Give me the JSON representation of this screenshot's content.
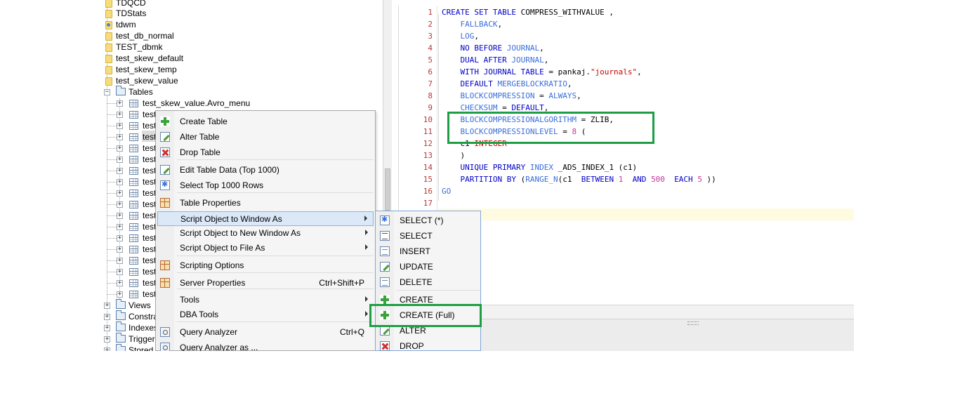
{
  "tree": {
    "top_items": [
      {
        "label": "TDQCD",
        "icon": "database-icon"
      },
      {
        "label": "TDStats",
        "icon": "database-icon"
      },
      {
        "label": "tdwm",
        "icon": "user-database-icon"
      },
      {
        "label": "test_db_normal",
        "icon": "database-icon"
      },
      {
        "label": "TEST_dbmk",
        "icon": "database-icon"
      },
      {
        "label": "test_skew_default",
        "icon": "database-icon"
      },
      {
        "label": "test_skew_temp",
        "icon": "database-icon"
      },
      {
        "label": "test_skew_value",
        "icon": "database-icon"
      }
    ],
    "tables_folder": "Tables",
    "first_table": "test_skew_value.Avro_menu",
    "truncated_table": "test",
    "bottom_folders": [
      "Views",
      "Constra",
      "Indexes",
      "Triggers",
      "Stored P"
    ]
  },
  "editor": {
    "line_numbers": [
      "1",
      "2",
      "3",
      "4",
      "5",
      "6",
      "7",
      "8",
      "9",
      "10",
      "11",
      "12",
      "13",
      "14",
      "15",
      "16",
      "17"
    ],
    "lines": [
      [
        {
          "t": "CREATE SET TABLE ",
          "c": "kw"
        },
        {
          "t": "COMPRESS_WITHVALUE ,",
          "c": ""
        }
      ],
      [
        {
          "t": "    FALLBACK",
          "c": "kw2"
        },
        {
          "t": ",",
          "c": ""
        }
      ],
      [
        {
          "t": "    LOG",
          "c": "kw2"
        },
        {
          "t": ",",
          "c": ""
        }
      ],
      [
        {
          "t": "    NO BEFORE ",
          "c": "kw"
        },
        {
          "t": "JOURNAL",
          "c": "kw2"
        },
        {
          "t": ",",
          "c": ""
        }
      ],
      [
        {
          "t": "    DUAL AFTER ",
          "c": "kw"
        },
        {
          "t": "JOURNAL",
          "c": "kw2"
        },
        {
          "t": ",",
          "c": ""
        }
      ],
      [
        {
          "t": "    WITH JOURNAL TABLE ",
          "c": "kw"
        },
        {
          "t": "= pankaj.",
          "c": ""
        },
        {
          "t": "\"journals\"",
          "c": "str"
        },
        {
          "t": ",",
          "c": ""
        }
      ],
      [
        {
          "t": "    DEFAULT ",
          "c": "kw"
        },
        {
          "t": "MERGEBLOCKRATIO",
          "c": "kw2"
        },
        {
          "t": ",",
          "c": ""
        }
      ],
      [
        {
          "t": "    BLOCKCOMPRESSION",
          "c": "kw2"
        },
        {
          "t": " = ",
          "c": ""
        },
        {
          "t": "ALWAYS",
          "c": "kw2"
        },
        {
          "t": ",",
          "c": ""
        }
      ],
      [
        {
          "t": "    CHECKSUM",
          "c": "kw2"
        },
        {
          "t": " = ",
          "c": ""
        },
        {
          "t": "DEFAULT",
          "c": "kw"
        },
        {
          "t": ",",
          "c": ""
        }
      ],
      [
        {
          "t": "    BLOCKCOMPRESSIONALGORITHM",
          "c": "kw2"
        },
        {
          "t": " = ZLIB,",
          "c": ""
        }
      ],
      [
        {
          "t": "    BLOCKCOMPRESSIONLEVEL",
          "c": "kw2"
        },
        {
          "t": " = ",
          "c": ""
        },
        {
          "t": "8",
          "c": "num"
        },
        {
          "t": " (",
          "c": ""
        }
      ],
      [
        {
          "t": "    c1 ",
          "c": ""
        },
        {
          "t": "INTEGER",
          "c": "str"
        }
      ],
      [
        {
          "t": "    )",
          "c": ""
        }
      ],
      [
        {
          "t": "    UNIQUE PRIMARY ",
          "c": "kw"
        },
        {
          "t": "INDEX",
          "c": "kw2"
        },
        {
          "t": " _ADS_INDEX_1 (c1)",
          "c": ""
        }
      ],
      [
        {
          "t": "    PARTITION BY ",
          "c": "kw"
        },
        {
          "t": "(",
          "c": ""
        },
        {
          "t": "RANGE_N",
          "c": "kw2"
        },
        {
          "t": "(c1  ",
          "c": ""
        },
        {
          "t": "BETWEEN ",
          "c": "kw"
        },
        {
          "t": "1",
          "c": "num"
        },
        {
          "t": "  ",
          "c": ""
        },
        {
          "t": "AND ",
          "c": "kw"
        },
        {
          "t": "500",
          "c": "num"
        },
        {
          "t": "  ",
          "c": ""
        },
        {
          "t": "EACH ",
          "c": "kw"
        },
        {
          "t": "5",
          "c": "num"
        },
        {
          "t": " ))",
          "c": ""
        }
      ],
      [
        {
          "t": "GO",
          "c": "kw2"
        }
      ],
      []
    ]
  },
  "context_menu": {
    "items": [
      {
        "label": "Create Table",
        "icon": "plus-icon"
      },
      {
        "label": "Alter Table",
        "icon": "edit-icon"
      },
      {
        "label": "Drop Table",
        "icon": "delete-icon"
      },
      {
        "label": "Edit Table Data (Top 1000)",
        "icon": "edit-icon"
      },
      {
        "label": "Select Top 1000 Rows",
        "icon": "select-icon"
      },
      {
        "label": "Table Properties",
        "icon": "properties-icon"
      },
      {
        "label": "Script Object to Window As",
        "icon": "",
        "submenu": true
      },
      {
        "label": "Script Object to New Window As",
        "icon": "",
        "submenu": true
      },
      {
        "label": "Script Object to File As",
        "icon": "",
        "submenu": true
      },
      {
        "label": "Scripting Options",
        "icon": "options-icon"
      },
      {
        "label": "Server Properties",
        "icon": "properties-icon",
        "shortcut": "Ctrl+Shift+P"
      },
      {
        "label": "Tools",
        "icon": "",
        "submenu": true
      },
      {
        "label": "DBA Tools",
        "icon": "",
        "submenu": true
      },
      {
        "label": "Query Analyzer",
        "icon": "query-icon",
        "shortcut": "Ctrl+Q"
      },
      {
        "label": "Query Analyzer as ...",
        "icon": "query-icon"
      }
    ]
  },
  "submenu": {
    "items": [
      {
        "label": "SELECT (*)",
        "icon": "select-star-icon"
      },
      {
        "label": "SELECT",
        "icon": "select-icon"
      },
      {
        "label": "INSERT",
        "icon": "insert-icon"
      },
      {
        "label": "UPDATE",
        "icon": "update-icon"
      },
      {
        "label": "DELETE",
        "icon": "delete-icon"
      },
      {
        "label": "CREATE",
        "icon": "create-icon"
      },
      {
        "label": "CREATE (Full)",
        "icon": "create-full-icon"
      },
      {
        "label": "ALTER",
        "icon": "alter-icon"
      },
      {
        "label": "DROP",
        "icon": "drop-icon"
      }
    ]
  },
  "colors": {
    "highlight_box": "#1e9e44",
    "keyword": "#0000c8",
    "keyword_secondary": "#3a6edb",
    "string": "#c80000",
    "number": "#c0399a",
    "line_number": "#b83a3a",
    "current_line": "#fffbe1"
  }
}
